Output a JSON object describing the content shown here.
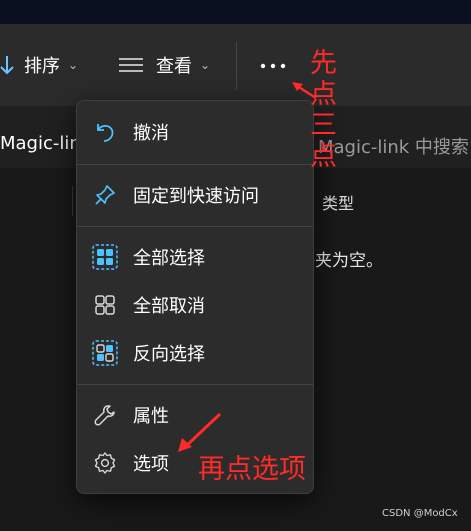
{
  "toolbar": {
    "sort_label": "排序",
    "view_label": "查看"
  },
  "address": {
    "path_text": "Magic-lin",
    "search_placeholder": "Magic-link 中搜索"
  },
  "file_list": {
    "type_column": "类型",
    "empty_message": "件夹为空。"
  },
  "menu": {
    "items": [
      {
        "label": "撤消",
        "icon": "undo-icon"
      },
      {
        "label": "固定到快速访问",
        "icon": "pin-icon"
      },
      {
        "label": "全部选择",
        "icon": "select-all-icon"
      },
      {
        "label": "全部取消",
        "icon": "select-none-icon"
      },
      {
        "label": "反向选择",
        "icon": "invert-selection-icon"
      },
      {
        "label": "属性",
        "icon": "wrench-icon"
      },
      {
        "label": "选项",
        "icon": "gear-icon"
      }
    ]
  },
  "annotations": {
    "first": "先点三点",
    "second": "再点选项"
  },
  "watermark": "CSDN @ModCx",
  "colors": {
    "accent": "#4cc2ff",
    "annotation": "#ff2a2a",
    "menu_bg": "#2c2c2c"
  }
}
